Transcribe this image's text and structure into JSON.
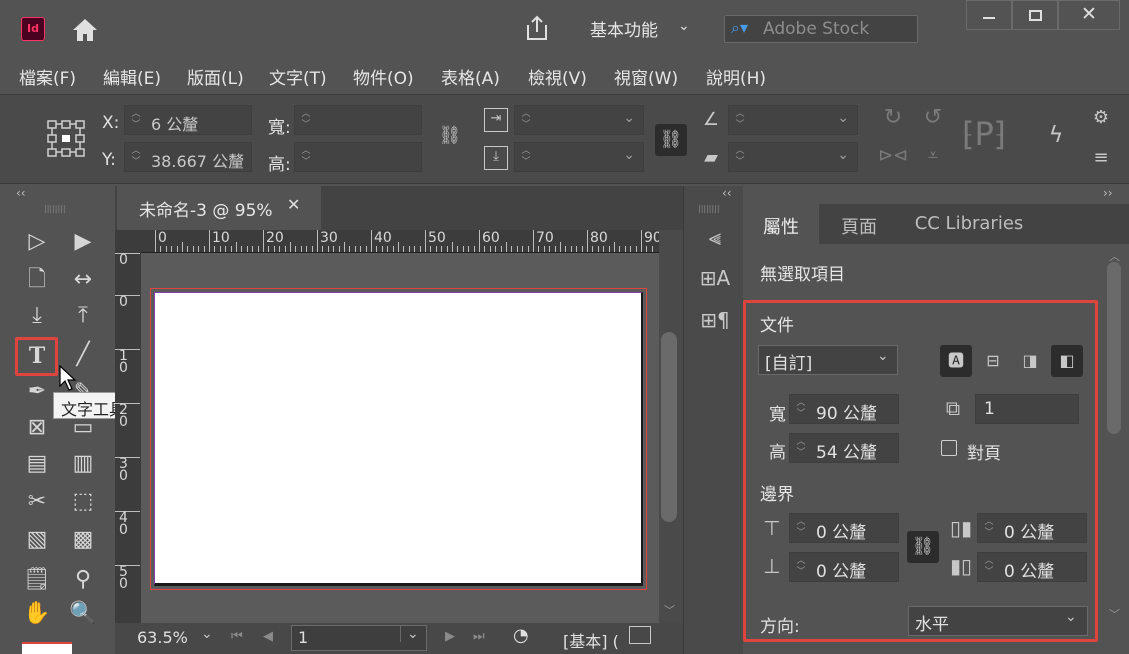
{
  "app": {
    "logo": "Id",
    "workspace": "基本功能",
    "search_placeholder": "Adobe Stock"
  },
  "menu": [
    "檔案(F)",
    "編輯(E)",
    "版面(L)",
    "文字(T)",
    "物件(O)",
    "表格(A)",
    "檢視(V)",
    "視窗(W)",
    "說明(H)"
  ],
  "control": {
    "x_label": "X:",
    "x_value": "6 公釐",
    "y_label": "Y:",
    "y_value": "38.667 公釐",
    "w_label": "寬:",
    "h_label": "高:"
  },
  "document": {
    "tab_title": "未命名-3 @ 95%",
    "zoom": "63.5%",
    "page": "1",
    "master": "[基本] (",
    "ruler_h": [
      "0",
      "10",
      "20",
      "30",
      "40",
      "50",
      "60",
      "70",
      "80",
      "90"
    ],
    "ruler_v": [
      "0",
      "0",
      "1\n0",
      "2\n0",
      "3\n0",
      "4\n0",
      "5\n0"
    ]
  },
  "tooltip": "文字工具 (T)",
  "properties": {
    "tabs": [
      "屬性",
      "頁面",
      "CC Libraries"
    ],
    "no_selection": "無選取項目",
    "doc_section": "文件",
    "preset": "[自訂]",
    "width_label": "寬",
    "width_value": "90 公釐",
    "height_label": "高",
    "height_value": "54 公釐",
    "pages_value": "1",
    "facing_label": "對頁",
    "margin_section": "邊界",
    "margin_top": "0 公釐",
    "margin_bottom": "0 公釐",
    "margin_inside": "0 公釐",
    "margin_outside": "0 公釐",
    "orientation_label": "方向:",
    "orientation_value": "水平"
  },
  "colors": {
    "accent_red": "#e0443e",
    "logo_bg": "#49021f",
    "logo_fg": "#ff3366"
  }
}
